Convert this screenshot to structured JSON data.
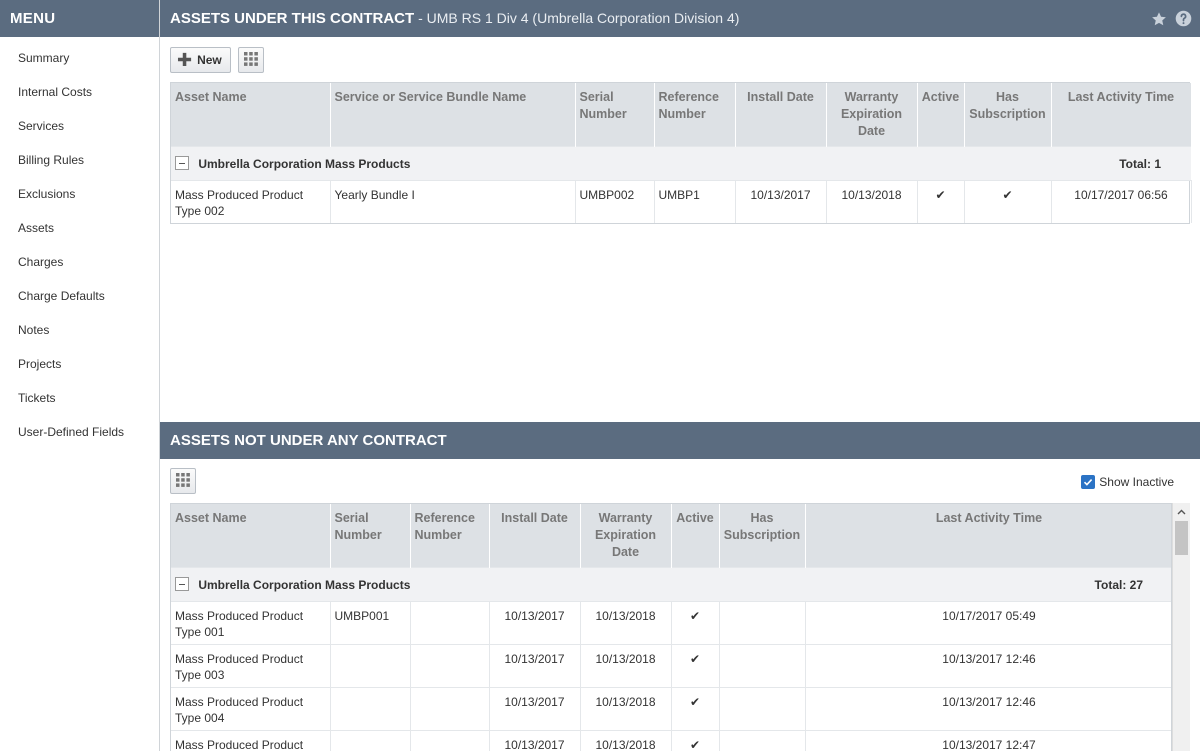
{
  "sidebar": {
    "title": "MENU",
    "items": [
      "Summary",
      "Internal Costs",
      "Services",
      "Billing Rules",
      "Exclusions",
      "Assets",
      "Charges",
      "Charge Defaults",
      "Notes",
      "Projects",
      "Tickets",
      "User-Defined Fields"
    ]
  },
  "section1": {
    "title": "ASSETS UNDER THIS CONTRACT",
    "subtitle": " - UMB RS 1 Div 4 (Umbrella Corporation Division 4)",
    "new_label": "New",
    "columns": [
      "Asset Name",
      "Service or Service Bundle Name",
      "Serial Number",
      "Reference Number",
      "Install Date",
      "Warranty Expiration Date",
      "Active",
      "Has Subscription",
      "Last Activity Time"
    ],
    "group": {
      "name": "Umbrella Corporation Mass Products",
      "total": "Total: 1"
    },
    "rows": [
      {
        "asset": "Mass Produced Product Type 002",
        "service": "Yearly Bundle I",
        "serial": "UMBP002",
        "reference": "UMBP1",
        "install": "10/13/2017",
        "warranty": "10/13/2018",
        "active": "✔",
        "subscription": "✔",
        "last": "10/17/2017 06:56"
      }
    ]
  },
  "section2": {
    "title": "ASSETS NOT UNDER ANY CONTRACT",
    "show_inactive_label": "Show Inactive",
    "show_inactive_checked": true,
    "columns": [
      "Asset Name",
      "Serial Number",
      "Reference Number",
      "Install Date",
      "Warranty Expiration Date",
      "Active",
      "Has Subscription",
      "Last Activity Time"
    ],
    "group": {
      "name": "Umbrella Corporation Mass Products",
      "total": "Total: 27"
    },
    "rows": [
      {
        "asset": "Mass Produced Product Type 001",
        "serial": "UMBP001",
        "reference": "",
        "install": "10/13/2017",
        "warranty": "10/13/2018",
        "active": "✔",
        "subscription": "",
        "last": "10/17/2017 05:49"
      },
      {
        "asset": "Mass Produced Product Type 003",
        "serial": "",
        "reference": "",
        "install": "10/13/2017",
        "warranty": "10/13/2018",
        "active": "✔",
        "subscription": "",
        "last": "10/13/2017 12:46"
      },
      {
        "asset": "Mass Produced Product Type 004",
        "serial": "",
        "reference": "",
        "install": "10/13/2017",
        "warranty": "10/13/2018",
        "active": "✔",
        "subscription": "",
        "last": "10/13/2017 12:46"
      },
      {
        "asset": "Mass Produced Product",
        "serial": "",
        "reference": "",
        "install": "10/13/2017",
        "warranty": "10/13/2018",
        "active": "✔",
        "subscription": "",
        "last": "10/13/2017 12:47"
      }
    ]
  },
  "icons": {
    "star": "star-icon",
    "help": "help-icon",
    "grid": "column-chooser-icon",
    "plus": "plus-icon"
  }
}
